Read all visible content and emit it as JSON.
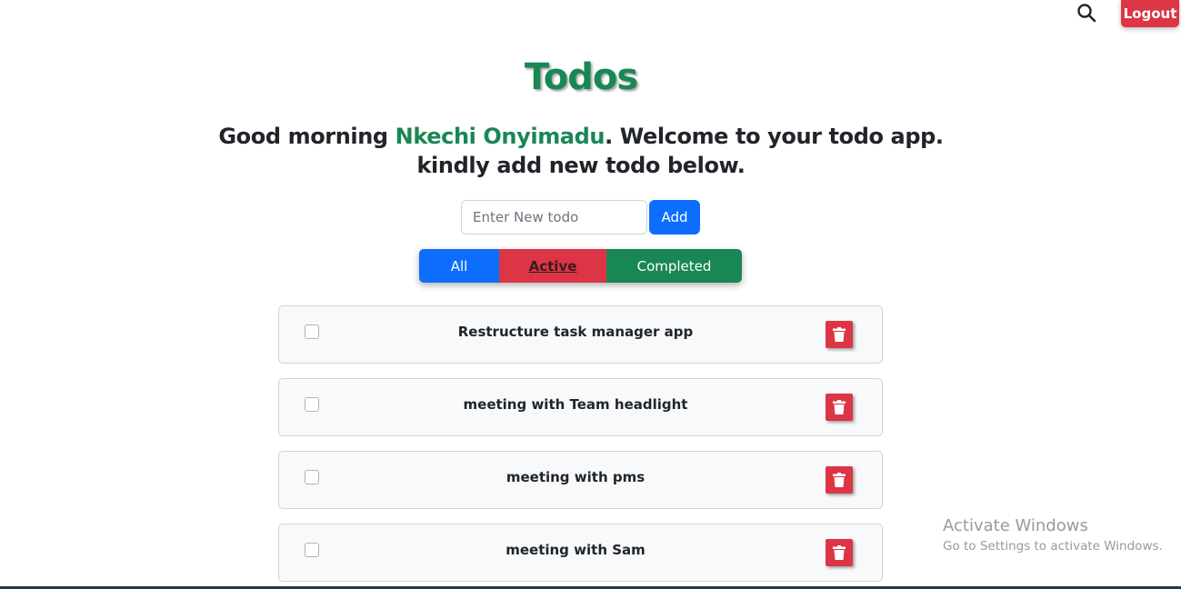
{
  "header": {
    "search_icon": "search-icon",
    "logout_label": "Logout"
  },
  "page": {
    "title": "Todos",
    "greeting_prefix": "Good morning ",
    "user_name": "Nkechi Onyimadu",
    "greeting_suffix": ". Welcome to your todo app.",
    "greeting_line2": "kindly add new todo below."
  },
  "add_form": {
    "placeholder": "Enter New todo",
    "value": "",
    "add_label": "Add"
  },
  "filters": [
    {
      "label": "All",
      "color": "#0d6efd"
    },
    {
      "label": "Active",
      "color": "#dc3545",
      "selected": true
    },
    {
      "label": "Completed",
      "color": "#198754"
    }
  ],
  "todos": [
    {
      "text": "Restructure task manager app",
      "checked": false
    },
    {
      "text": "meeting with Team headlight",
      "checked": false
    },
    {
      "text": "meeting with pms",
      "checked": false
    },
    {
      "text": "meeting with Sam",
      "checked": false
    }
  ],
  "watermark": {
    "title": "Activate Windows",
    "subtitle": "Go to Settings to activate Windows."
  },
  "colors": {
    "accent_green": "#198754",
    "primary_blue": "#0d6efd",
    "danger_red": "#dc3545"
  }
}
